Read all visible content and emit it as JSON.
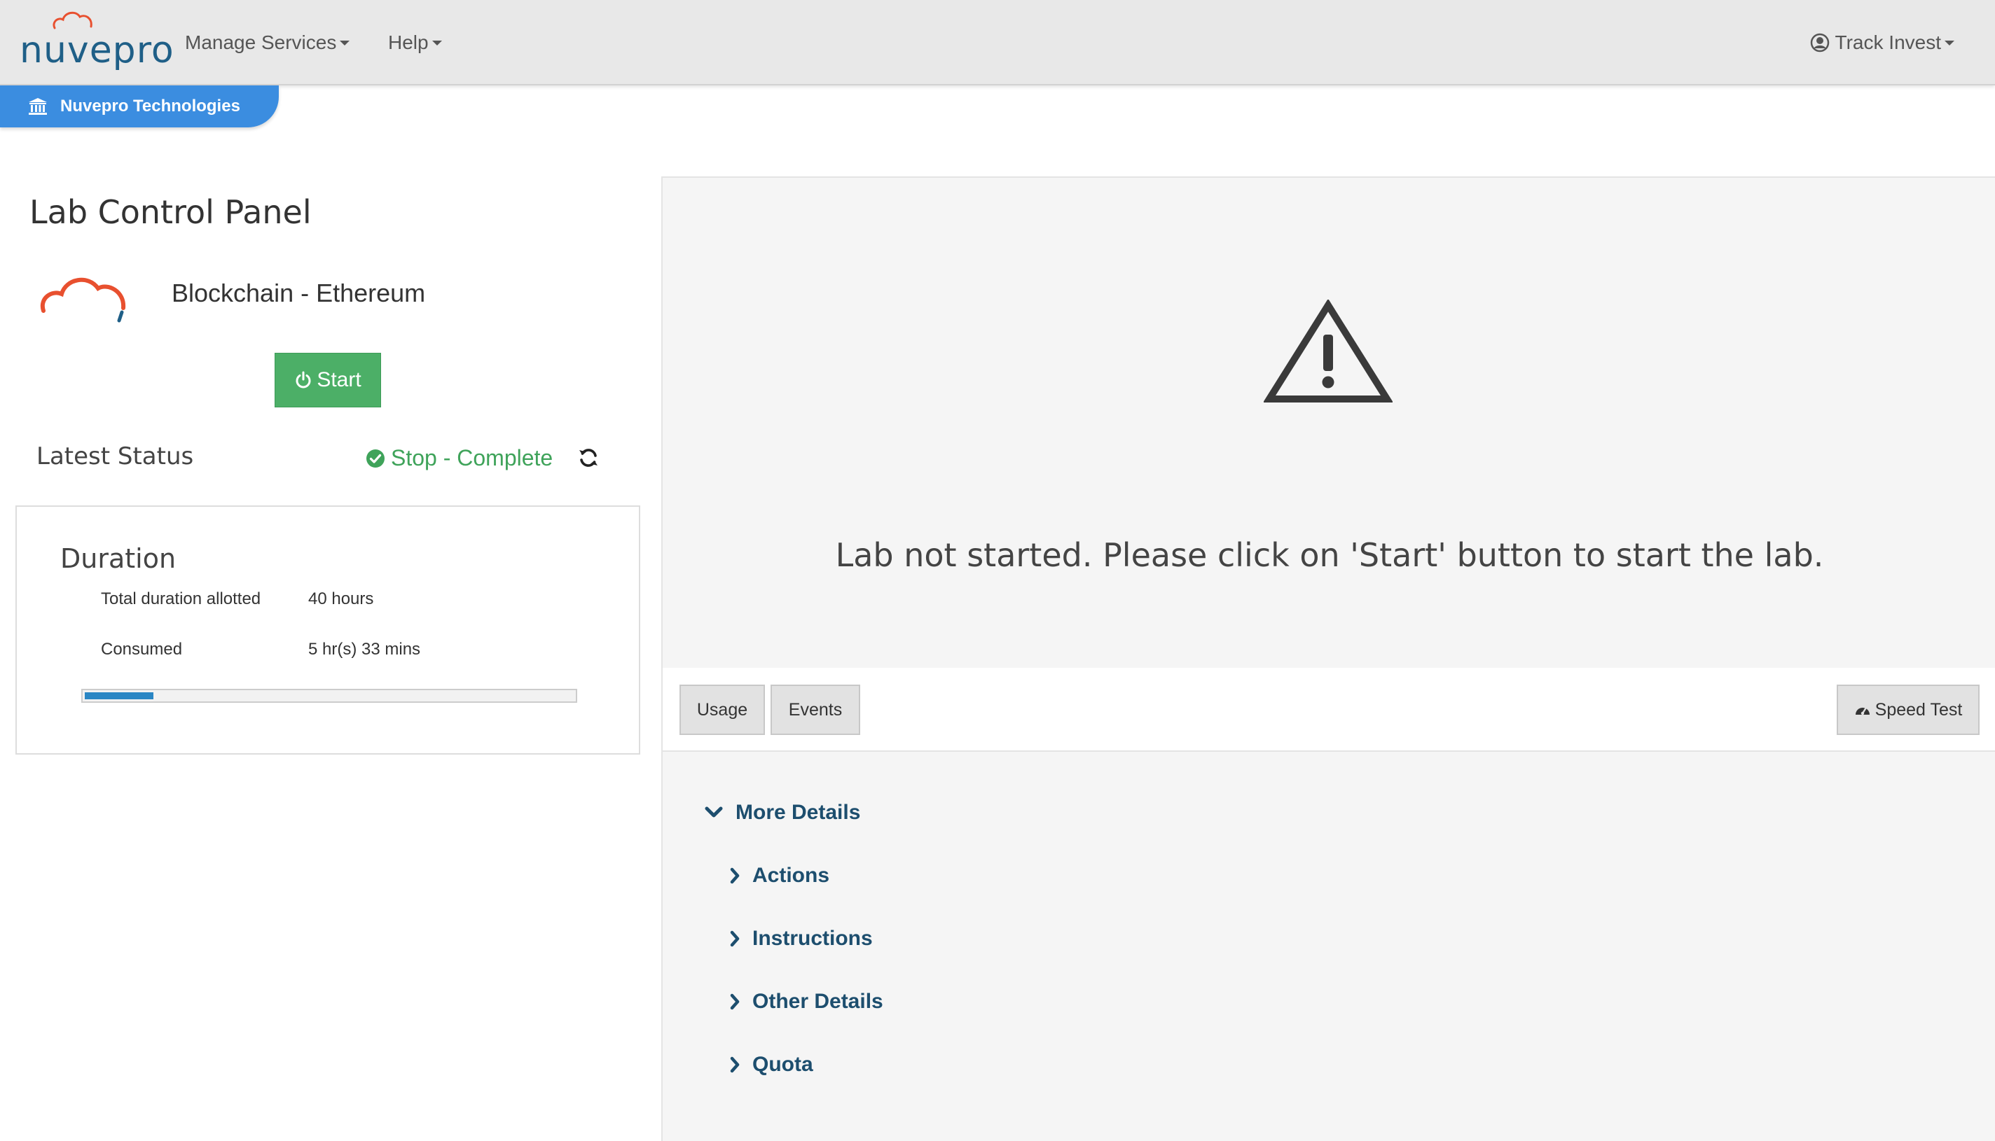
{
  "navbar": {
    "brand": "nuvepro",
    "menu": [
      {
        "label": "Manage Services"
      },
      {
        "label": "Help"
      }
    ],
    "user": {
      "label": "Track Invest"
    }
  },
  "org_tab": {
    "label": "Nuvepro Technologies"
  },
  "left": {
    "title": "Lab Control Panel",
    "lab_name": "Blockchain - Ethereum",
    "start_button": "Start",
    "status": {
      "label": "Latest Status",
      "value": "Stop - Complete"
    },
    "duration": {
      "title": "Duration",
      "total_label": "Total duration allotted",
      "total_value": "40 hours",
      "consumed_label": "Consumed",
      "consumed_value": "5 hr(s) 33 mins",
      "progress_fraction": 0.14
    }
  },
  "right": {
    "message": "Lab not started. Please click on 'Start' button to start the lab.",
    "tabs": {
      "usage": "Usage",
      "events": "Events",
      "speed_test": "Speed Test"
    },
    "details": {
      "more": "More Details",
      "items": [
        "Actions",
        "Instructions",
        "Other Details",
        "Quota"
      ]
    }
  },
  "colors": {
    "brand": "#1f5f87",
    "accent_orange": "#e8502f",
    "org_tab": "#3b8de0",
    "start": "#4caf67",
    "status_ok": "#3fa35a",
    "link": "#1d4e6e",
    "progress": "#2a86c4"
  },
  "icons": {
    "org": "bank-icon",
    "status": "check-circle-icon",
    "refresh": "refresh-icon",
    "warning": "warning-triangle-icon",
    "speed": "dashboard-icon",
    "user": "user-circle-icon"
  }
}
